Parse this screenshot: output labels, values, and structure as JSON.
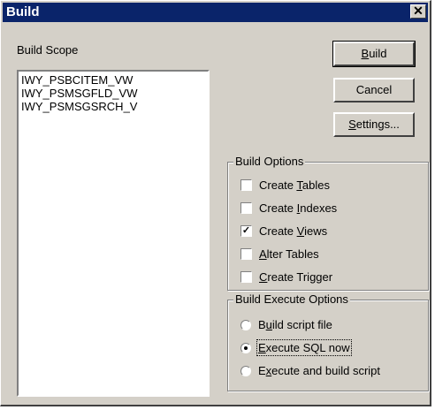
{
  "window": {
    "title": "Build",
    "close_glyph": "✕"
  },
  "build_scope": {
    "label": "Build Scope",
    "items": [
      "IWY_PSBCITEM_VW",
      "IWY_PSMSGFLD_VW",
      "IWY_PSMSGSRCH_V"
    ]
  },
  "buttons": {
    "build": "Build",
    "cancel": "Cancel",
    "settings": "Settings..."
  },
  "build_options": {
    "title": "Build Options",
    "items": [
      {
        "label": "Create Tables",
        "checked": false
      },
      {
        "label": "Create Indexes",
        "checked": false
      },
      {
        "label": "Create Views",
        "checked": true
      },
      {
        "label": "Alter Tables",
        "checked": false
      },
      {
        "label": "Create Trigger",
        "checked": false
      }
    ]
  },
  "execute_options": {
    "title": "Build Execute Options",
    "items": [
      {
        "label": "Build script file",
        "selected": false
      },
      {
        "label": "Execute SQL now",
        "selected": true
      },
      {
        "label": "Execute and build script",
        "selected": false
      }
    ]
  },
  "colors": {
    "titlebar": "#0a246a",
    "face": "#d4d0c8"
  }
}
